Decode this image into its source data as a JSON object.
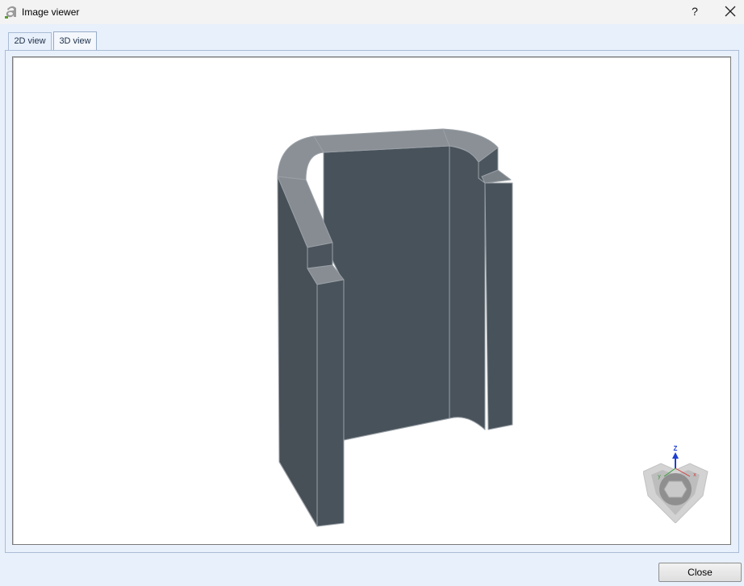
{
  "window": {
    "title": "Image viewer",
    "help_label": "?",
    "app_icon": "app-logo-a",
    "close_icon": "close-x-icon"
  },
  "tabs": [
    {
      "label": "2D view",
      "active": false
    },
    {
      "label": "3D view",
      "active": true
    }
  ],
  "viewer": {
    "background": "#ffffff",
    "model_color": "#48525b",
    "edge_color": "#9aa0a6"
  },
  "navcube": {
    "axes": {
      "z": "Z",
      "x": "x",
      "y": "y"
    },
    "z_color": "#1f3fd0",
    "x_color": "#d04040",
    "y_color": "#3a9a3a"
  },
  "footer": {
    "close_label": "Close"
  }
}
